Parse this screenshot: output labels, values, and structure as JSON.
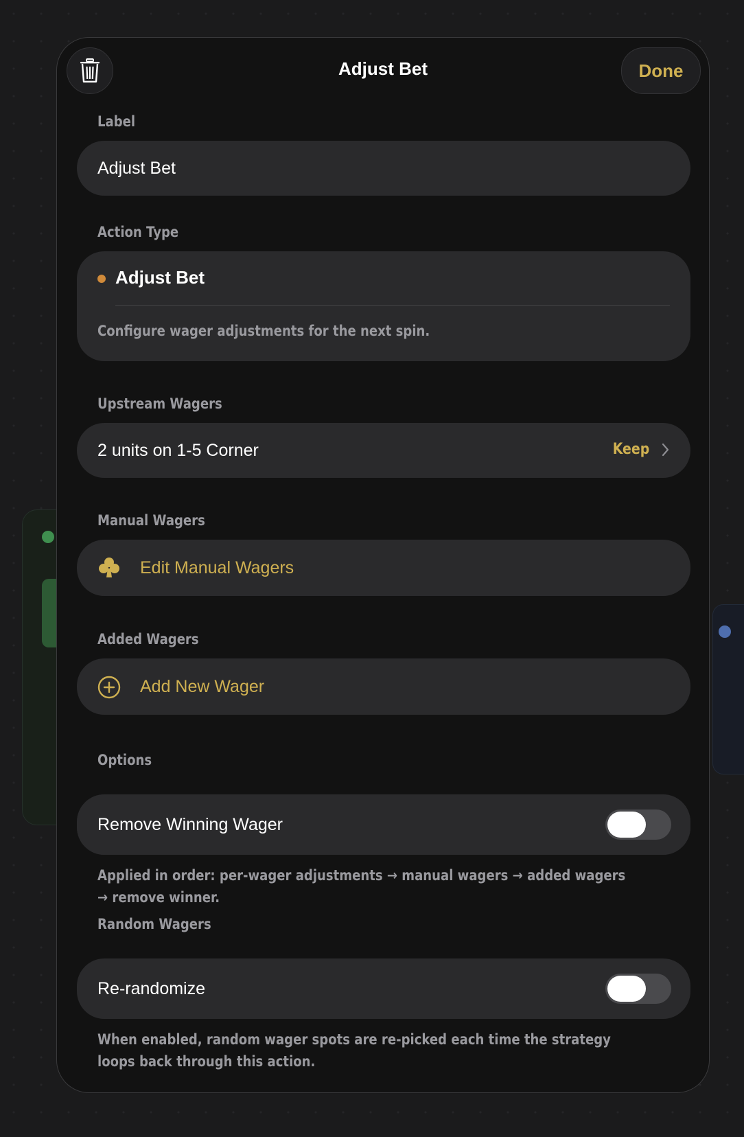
{
  "header": {
    "title": "Adjust Bet",
    "done_label": "Done"
  },
  "sections": {
    "label": {
      "title": "Label",
      "value": "Adjust Bet"
    },
    "action_type": {
      "title": "Action Type",
      "name": "Adjust Bet",
      "description": "Configure wager adjustments for the next spin."
    },
    "upstream_wagers": {
      "title": "Upstream Wagers",
      "item": "2 units on 1-5 Corner",
      "status": "Keep"
    },
    "manual_wagers": {
      "title": "Manual Wagers",
      "button": "Edit Manual Wagers"
    },
    "added_wagers": {
      "title": "Added Wagers",
      "button": "Add New Wager"
    },
    "options": {
      "title": "Options",
      "toggle_label": "Remove Winning Wager",
      "toggle_on": false,
      "note": "Applied in order: per-wager adjustments → manual wagers → added wagers → remove winner."
    },
    "random_wagers": {
      "title": "Random Wagers",
      "toggle_label": "Re-randomize",
      "toggle_on": false,
      "note": "When enabled, random wager spots are re-picked each time the strategy loops back through this action."
    }
  },
  "colors": {
    "accent_gold": "#cfb051",
    "action_dot": "#d08a3a",
    "row_bg": "#2a2a2c",
    "modal_bg": "#121212"
  },
  "icons": {
    "delete": "trash-icon",
    "manual": "club-icon",
    "add": "plus-circle-icon",
    "disclosure": "chevron-right-icon"
  }
}
